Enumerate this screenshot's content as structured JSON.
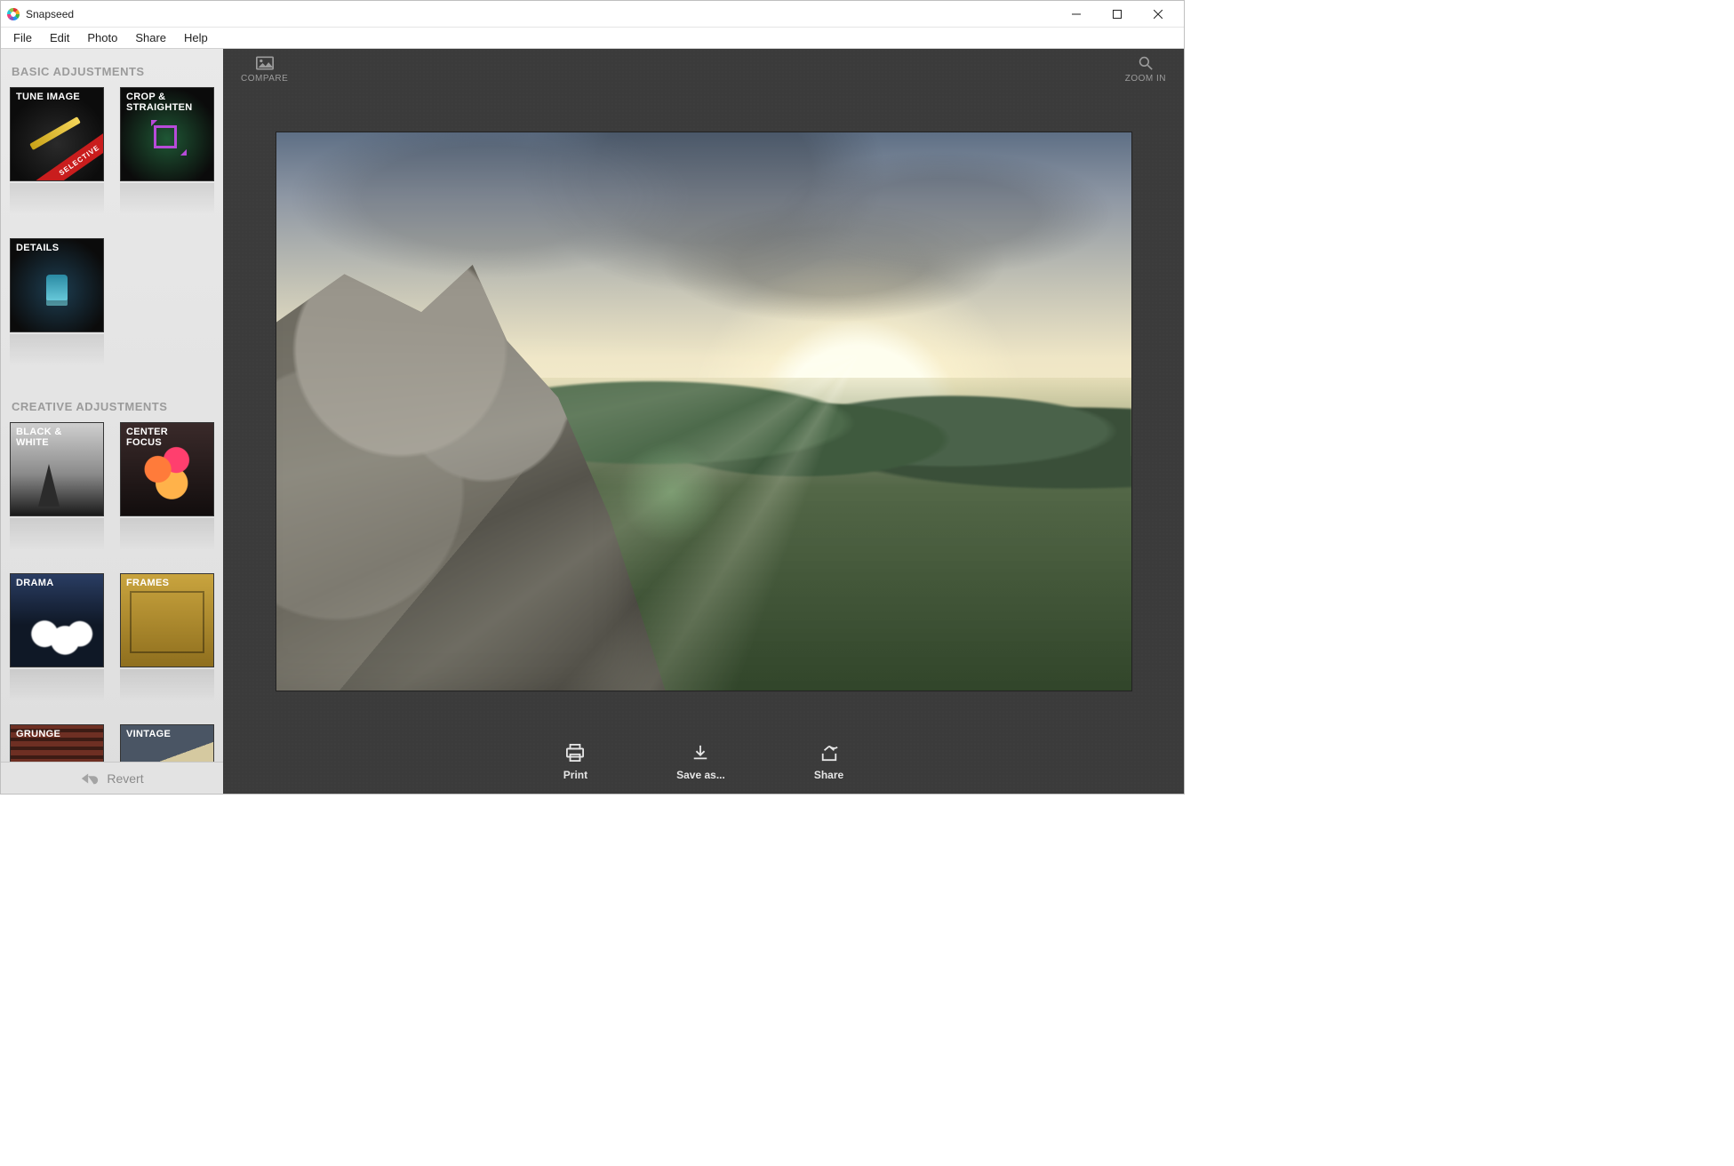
{
  "window": {
    "title": "Snapseed"
  },
  "menu": {
    "items": [
      "File",
      "Edit",
      "Photo",
      "Share",
      "Help"
    ]
  },
  "sidebar": {
    "basic_heading": "BASIC ADJUSTMENTS",
    "creative_heading": "CREATIVE ADJUSTMENTS",
    "basic": [
      {
        "label": "TUNE IMAGE",
        "ribbon": "SELECTIVE"
      },
      {
        "label": "CROP & STRAIGHTEN"
      },
      {
        "label": "DETAILS"
      }
    ],
    "creative": [
      {
        "label": "BLACK & WHITE"
      },
      {
        "label": "CENTER FOCUS"
      },
      {
        "label": "DRAMA"
      },
      {
        "label": "FRAMES"
      },
      {
        "label": "GRUNGE"
      },
      {
        "label": "VINTAGE"
      }
    ],
    "revert_label": "Revert"
  },
  "stage": {
    "compare_label": "COMPARE",
    "zoom_label": "ZOOM IN",
    "actions": {
      "print": "Print",
      "save": "Save as...",
      "share": "Share"
    }
  }
}
